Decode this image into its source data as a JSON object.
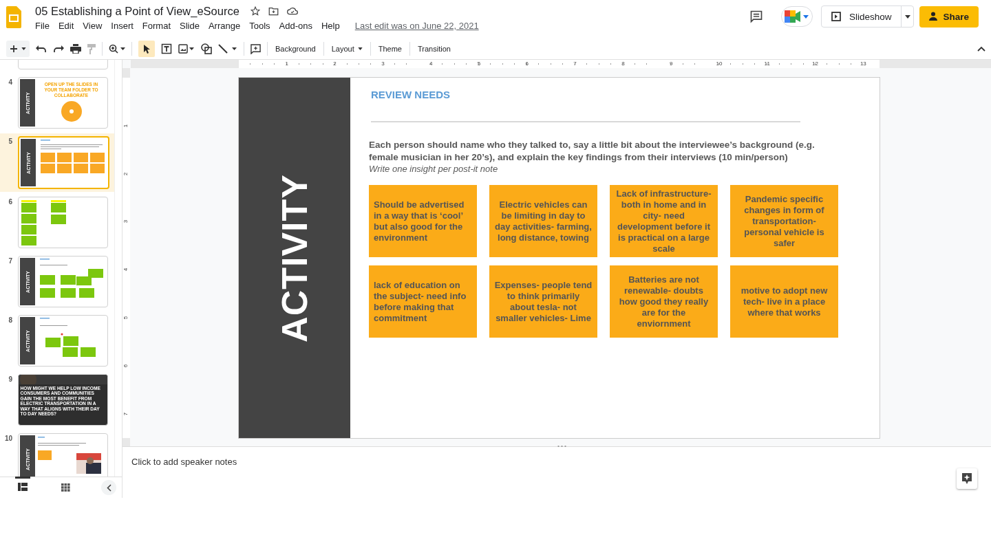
{
  "document": {
    "title": "05 Establishing a Point of View_eSource",
    "last_edit": "Last edit was on June 22, 2021"
  },
  "menu": [
    "File",
    "Edit",
    "View",
    "Insert",
    "Format",
    "Slide",
    "Arrange",
    "Tools",
    "Add-ons",
    "Help"
  ],
  "header_buttons": {
    "slideshow": "Slideshow",
    "share": "Share"
  },
  "toolbar": [
    {
      "label": "Background",
      "dropdown": false
    },
    {
      "label": "Layout",
      "dropdown": true
    },
    {
      "label": "Theme",
      "dropdown": false
    },
    {
      "label": "Transition",
      "dropdown": false
    }
  ],
  "ruler": {
    "horizontal": [
      "1",
      "2",
      "3",
      "4",
      "5",
      "6",
      "7",
      "8",
      "9",
      "10",
      "11",
      "12",
      "13"
    ],
    "vertical": [
      "1",
      "2",
      "3",
      "4",
      "5",
      "6",
      "7"
    ]
  },
  "slides": [
    {
      "kind": "partial",
      "selected": false
    },
    {
      "number": "4",
      "kind": "title",
      "sidebar_label": "ACTIVITY",
      "title": "OPEN UP THE SLIDES IN YOUR TEAM FOLDER TO COLLABORATE",
      "selected": false
    },
    {
      "number": "5",
      "kind": "orange-notes",
      "sidebar_label": "ACTIVITY",
      "selected": true
    },
    {
      "number": "6",
      "kind": "green-columns",
      "selected": false
    },
    {
      "number": "7",
      "kind": "green-notes",
      "sidebar_label": "ACTIVITY",
      "selected": false
    },
    {
      "number": "8",
      "kind": "green-scatter",
      "sidebar_label": "ACTIVITY",
      "selected": false
    },
    {
      "number": "9",
      "kind": "photo-question",
      "title": "HOW MIGHT WE HELP LOW INCOME CONSUMERS AND COMMUNITIES GAIN THE MOST BENEFIT FROM ELECTRIC TRANSPORTATION IN A WAY THAT ALIGNS WITH THEIR DAY TO DAY NEEDS?",
      "selected": false
    },
    {
      "number": "10",
      "kind": "photo-note",
      "sidebar_label": "ACTIVITY",
      "selected": false
    }
  ],
  "slide": {
    "sidebar_label": "ACTIVITY",
    "heading": "REVIEW NEEDS",
    "instructions": "Each person should name who they talked to, say a little bit about the interviewee’s background (e.g. female musician in her 20’s), and explain the key findings from their interviews (10 min/person)",
    "hint": "Write one insight per post-it note",
    "notes": [
      "Should be advertised in a way that is ‘cool’ but also good for the environment",
      "Electric vehicles can be limiting in day to day activities- farming, long distance, towing",
      "Lack of infrastructure- both in home and in city- need development before it is practical on a large scale",
      "Pandemic specific changes in form of transportation- personal vehicle is safer",
      "lack of education on the subject- need info before making that commitment",
      "Expenses- people tend to think primarily about tesla- not smaller vehicles- Lime",
      "Batteries are not renewable- doubts how good they really are for the enviornment",
      "motive to adopt new tech- live in a place where that works"
    ]
  },
  "speaker_notes": {
    "placeholder": "Click to add speaker notes"
  }
}
